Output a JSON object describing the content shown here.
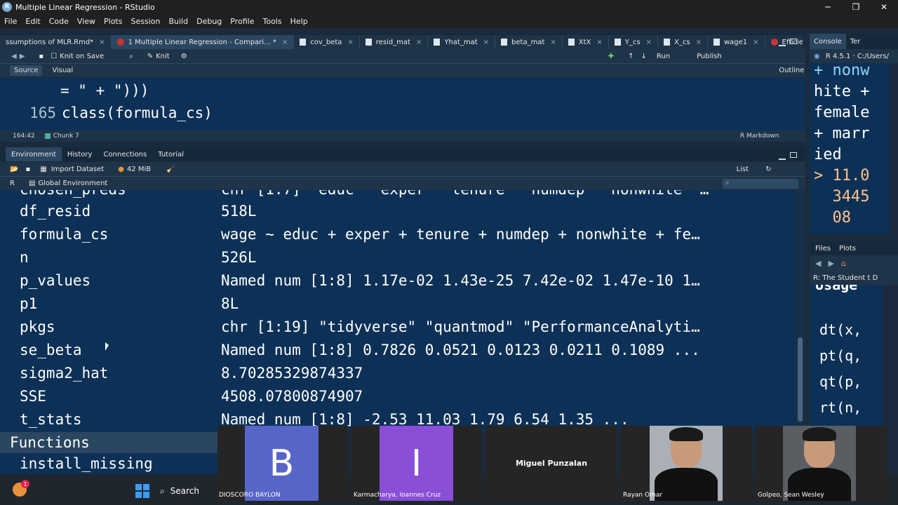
{
  "window": {
    "title": "Multiple Linear Regression - RStudio"
  },
  "menu": [
    "File",
    "Edit",
    "Code",
    "View",
    "Plots",
    "Session",
    "Build",
    "Debug",
    "Profile",
    "Tools",
    "Help"
  ],
  "source_tabs": [
    {
      "label": "ssumptions of MLR.Rmd*",
      "type": "rmd"
    },
    {
      "label": "1 Multiple Linear Regression - Compari... *",
      "type": "rmd",
      "active": true
    },
    {
      "label": "cov_beta",
      "type": "data"
    },
    {
      "label": "resid_mat",
      "type": "data"
    },
    {
      "label": "Yhat_mat",
      "type": "data"
    },
    {
      "label": "beta_mat",
      "type": "data"
    },
    {
      "label": "XtX",
      "type": "data"
    },
    {
      "label": "Y_cs",
      "type": "data"
    },
    {
      "label": "X_cs",
      "type": "data"
    },
    {
      "label": "wage1",
      "type": "data"
    },
    {
      "label": "Efficient Frontier",
      "type": "rmd"
    }
  ],
  "source_toolbar": {
    "knit_on_save": "Knit on Save",
    "knit": "Knit",
    "run": "Run",
    "publish": "Publish",
    "source_btn": "Source",
    "visual_btn": "Visual",
    "outline": "Outline"
  },
  "editor": {
    "line_a_text": "= \" + \")))",
    "line_b_num": "165",
    "line_b_text": "class(formula_cs)"
  },
  "source_status": {
    "position": "164:42",
    "chunk": "Chunk 7",
    "mode": "R Markdown"
  },
  "env_tabs": [
    "Environment",
    "History",
    "Connections",
    "Tutorial"
  ],
  "env_toolbar": {
    "import_dataset": "Import Dataset",
    "memory": "42 MiB",
    "list": "List",
    "lang": "R",
    "scope": "Global Environment"
  },
  "env_rows": [
    {
      "name": "chosen_preds",
      "value": "chr [1:7] \"educ\" \"exper\" \"tenure\" \"numdep\" \"nonwhite\" …"
    },
    {
      "name": "df_resid",
      "value": "518L"
    },
    {
      "name": "formula_cs",
      "value": "wage ~ educ + exper + tenure + numdep + nonwhite + fe…"
    },
    {
      "name": "n",
      "value": "526L"
    },
    {
      "name": "p_values",
      "value": "Named num [1:8] 1.17e-02 1.43e-25 7.42e-02 1.47e-10 1…"
    },
    {
      "name": "p1",
      "value": "8L"
    },
    {
      "name": "pkgs",
      "value": "chr [1:19] \"tidyverse\" \"quantmod\" \"PerformanceAnalyti…"
    },
    {
      "name": "se_beta",
      "value": "Named num [1:8] 0.7826 0.0521 0.0123 0.0211 0.1089 ..."
    },
    {
      "name": "sigma2_hat",
      "value": "8.70285329874337"
    },
    {
      "name": "SSE",
      "value": "4508.07800874907"
    },
    {
      "name": "t_stats",
      "value": "Named num [1:8] -2.53 11.03 1.79 6.54 1.35 ..."
    }
  ],
  "functions": {
    "header": "Functions",
    "first": "install_missing"
  },
  "console": {
    "tabs": [
      "Console",
      "Ter"
    ],
    "version": "R 4.5.1 · C:/Users/",
    "lines": [
      {
        "text": "+ nonw",
        "kind": "prompt"
      },
      {
        "text": "hite +",
        "kind": "plain"
      },
      {
        "text": "female",
        "kind": "plain"
      },
      {
        "text": "+ marr",
        "kind": "plain"
      },
      {
        "text": "ied",
        "kind": "plain"
      },
      {
        "text": "> 11.0",
        "kind": "out"
      },
      {
        "text": "  3445",
        "kind": "out"
      },
      {
        "text": "  08",
        "kind": "out"
      }
    ]
  },
  "files_pane": {
    "tabs": [
      "Files",
      "Plots"
    ],
    "help_title": "R: The Student t D",
    "help_heading": "Usage",
    "help_lines": [
      "dt(x,",
      "pt(q,",
      "qt(p,",
      "rt(n,"
    ]
  },
  "taskbar": {
    "search": "Search",
    "badge": "1"
  },
  "call_tiles": [
    {
      "initial": "B",
      "caption": "DIOSCORO BAYLON",
      "color": "#5865c8"
    },
    {
      "initial": "I",
      "caption": "Karmacharya, Ioannes Cruz",
      "color": "#8a4fd6"
    },
    {
      "center_name": "Miguel Punzalan"
    },
    {
      "caption": "Rayan Omar"
    },
    {
      "caption": "Golpeo, Sean Wesley"
    }
  ],
  "colors": {
    "editor_bg": "#0d3156",
    "pane_bg": "#1f3449",
    "tab_bg": "#16293a"
  }
}
